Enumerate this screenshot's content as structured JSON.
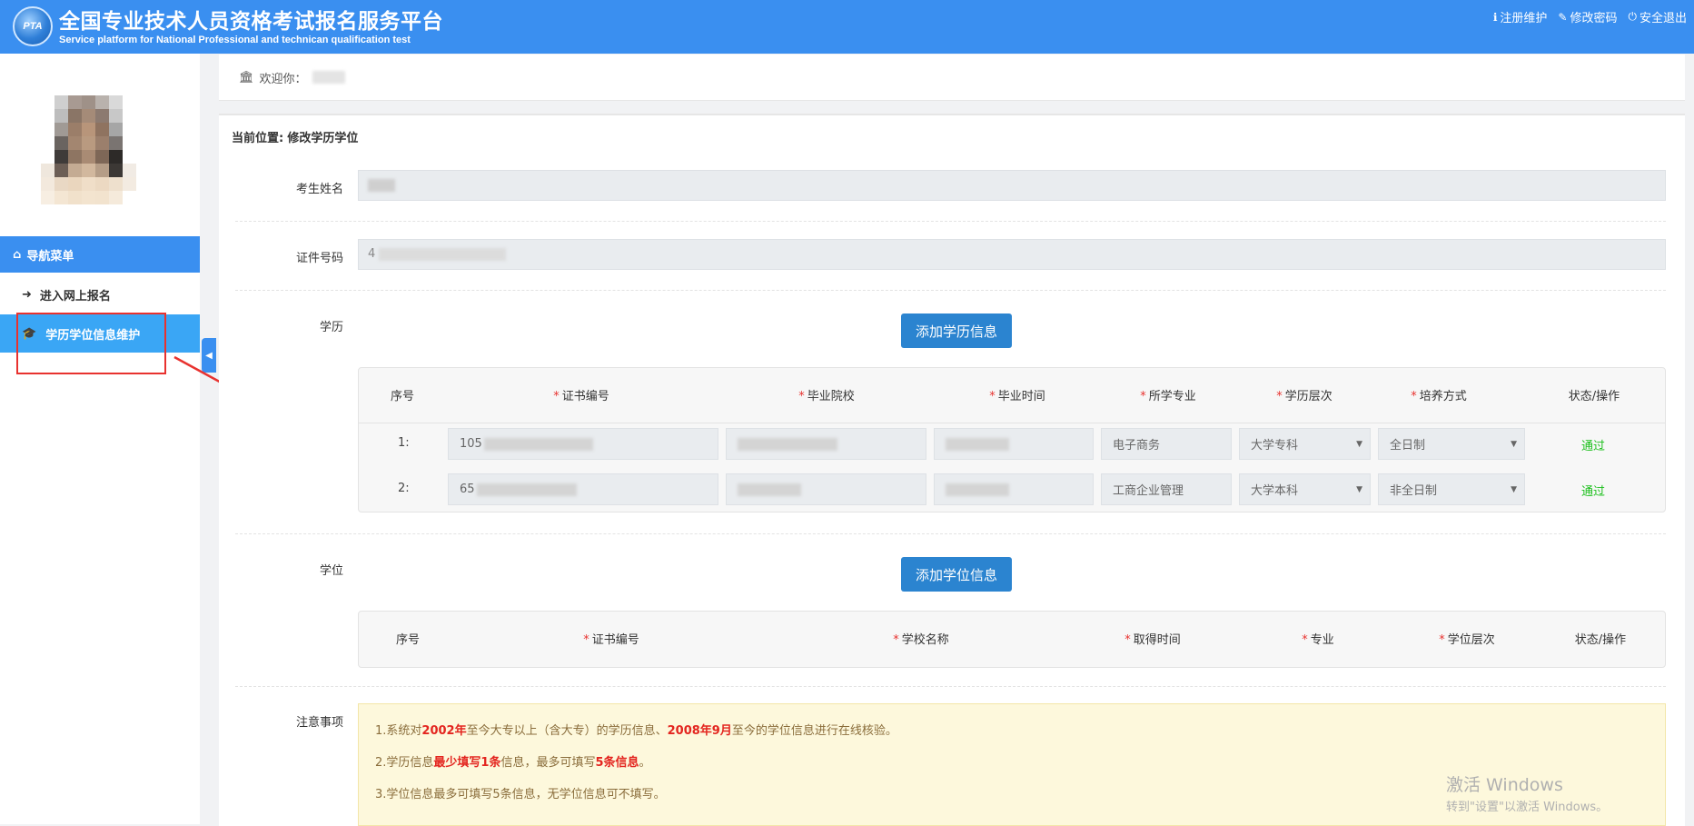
{
  "header": {
    "logo_text": "PTA",
    "title": "全国专业技术人员资格考试报名服务平台",
    "subtitle": "Service platform for National Professional and technican qualification test",
    "links": [
      {
        "label": "注册维护",
        "icon": "info-icon"
      },
      {
        "label": "修改密码",
        "icon": "edit-icon"
      },
      {
        "label": "安全退出",
        "icon": "power-icon"
      }
    ]
  },
  "sidebar": {
    "nav_title": "导航菜单",
    "items": [
      {
        "label": "进入网上报名",
        "icon": "sign-in-icon"
      },
      {
        "label": "学历学位信息维护",
        "icon": "graduation-cap-icon",
        "active": true
      }
    ]
  },
  "welcome": {
    "label": "欢迎你："
  },
  "breadcrumb": {
    "prefix": "当前位置:",
    "current": "修改学历学位"
  },
  "form": {
    "name_label": "考生姓名",
    "id_label": "证件号码",
    "id_value_partial": "4",
    "education_label": "学历",
    "degree_label": "学位",
    "notice_label": "注意事项"
  },
  "education": {
    "add_button": "添加学历信息",
    "headers": [
      "序号",
      "证书编号",
      "毕业院校",
      "毕业时间",
      "所学专业",
      "学历层次",
      "培养方式",
      "状态/操作"
    ],
    "rows": [
      {
        "no": "1:",
        "cert": "105",
        "major": "电子商务",
        "level": "大学专科",
        "mode": "全日制",
        "status": "通过"
      },
      {
        "no": "2:",
        "cert": "65",
        "major": "工商企业管理",
        "level": "大学本科",
        "mode": "非全日制",
        "status": "通过"
      }
    ]
  },
  "degree": {
    "add_button": "添加学位信息",
    "headers": [
      "序号",
      "证书编号",
      "学校名称",
      "取得时间",
      "专业",
      "学位层次",
      "状态/操作"
    ]
  },
  "notice": {
    "line1": {
      "a": "1.系统对",
      "b": "2002年",
      "c": "至今大专以上（含大专）的学历信息、",
      "d": "2008年9月",
      "e": "至今的学位信息进行在线核验。"
    },
    "line2": {
      "a": "2.学历信息",
      "b": "最少填写1条",
      "c": "信息，最多可填写",
      "d": "5条信息",
      "e": "。"
    },
    "line3": "3.学位信息最多可填写5条信息，无学位信息可不填写。"
  },
  "watermark": {
    "line1": "激活 Windows",
    "line2": "转到\"设置\"以激活 Windows。"
  },
  "colors": {
    "header": "#3a8ff0",
    "button": "#2b84d0",
    "pass": "#1bbf1b",
    "annotation": "#e8322f"
  }
}
